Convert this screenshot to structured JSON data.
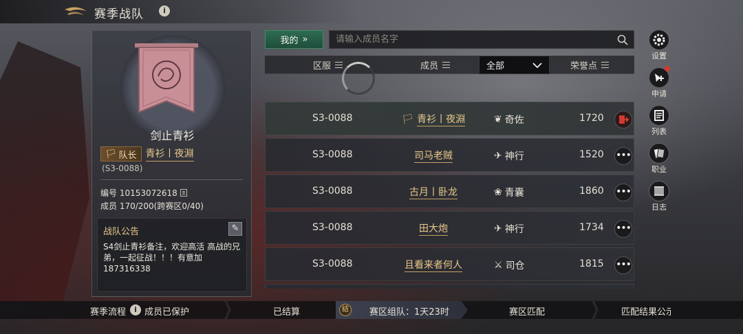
{
  "header": {
    "title": "赛季战队"
  },
  "team": {
    "name": "剑止青衫",
    "leader_label": "队长",
    "leader_name": "青衫丨夜淵",
    "server_code": "(S3-0088)",
    "id_line": "编号 10153072618",
    "members_line": "成员 170/200(跨赛区0/40)",
    "notice_title": "战队公告",
    "notice_text": "S4剑止青衫备注，欢迎高活 高战的兄弟，一起征战！！！有意加187316338"
  },
  "toolbar": {
    "my_label": "我的",
    "search_placeholder": "请输入成员名字"
  },
  "table": {
    "headers": {
      "server": "区服",
      "member": "成员",
      "filter_value": "全部",
      "honor": "荣誉点"
    },
    "rows": [
      {
        "server": "S3-0088",
        "name": "青衫丨夜淵",
        "class": "奇佐",
        "points": "1720",
        "leader": true
      },
      {
        "server": "S3-0088",
        "name": "司马老贼",
        "class": "神行",
        "points": "1520"
      },
      {
        "server": "S3-0088",
        "name": "古月丨卧龙",
        "class": "青囊",
        "points": "1860"
      },
      {
        "server": "S3-0088",
        "name": "田大炮",
        "class": "神行",
        "points": "1734"
      },
      {
        "server": "S3-0088",
        "name": "且看来者何人",
        "class": "司仓",
        "points": "1815"
      }
    ],
    "more_label": "•••"
  },
  "side_menu": [
    {
      "label": "设置",
      "icon": "gear-icon"
    },
    {
      "label": "申请",
      "icon": "apply-icon"
    },
    {
      "label": "列表",
      "icon": "list-icon"
    },
    {
      "label": "职业",
      "icon": "cards-icon"
    },
    {
      "label": "日志",
      "icon": "log-icon"
    }
  ],
  "footer": {
    "season_flow": "赛季流程",
    "protected": "成员已保护",
    "settled": "已结算",
    "stage_mark": "结",
    "current_stage": "赛区组队：1天23时",
    "zone_match": "赛区匹配",
    "match_result": "匹配结果公示"
  },
  "colors": {
    "gold": "#e9c98b",
    "green_button": "#2e6b52",
    "red_dot": "#d23a2f"
  }
}
